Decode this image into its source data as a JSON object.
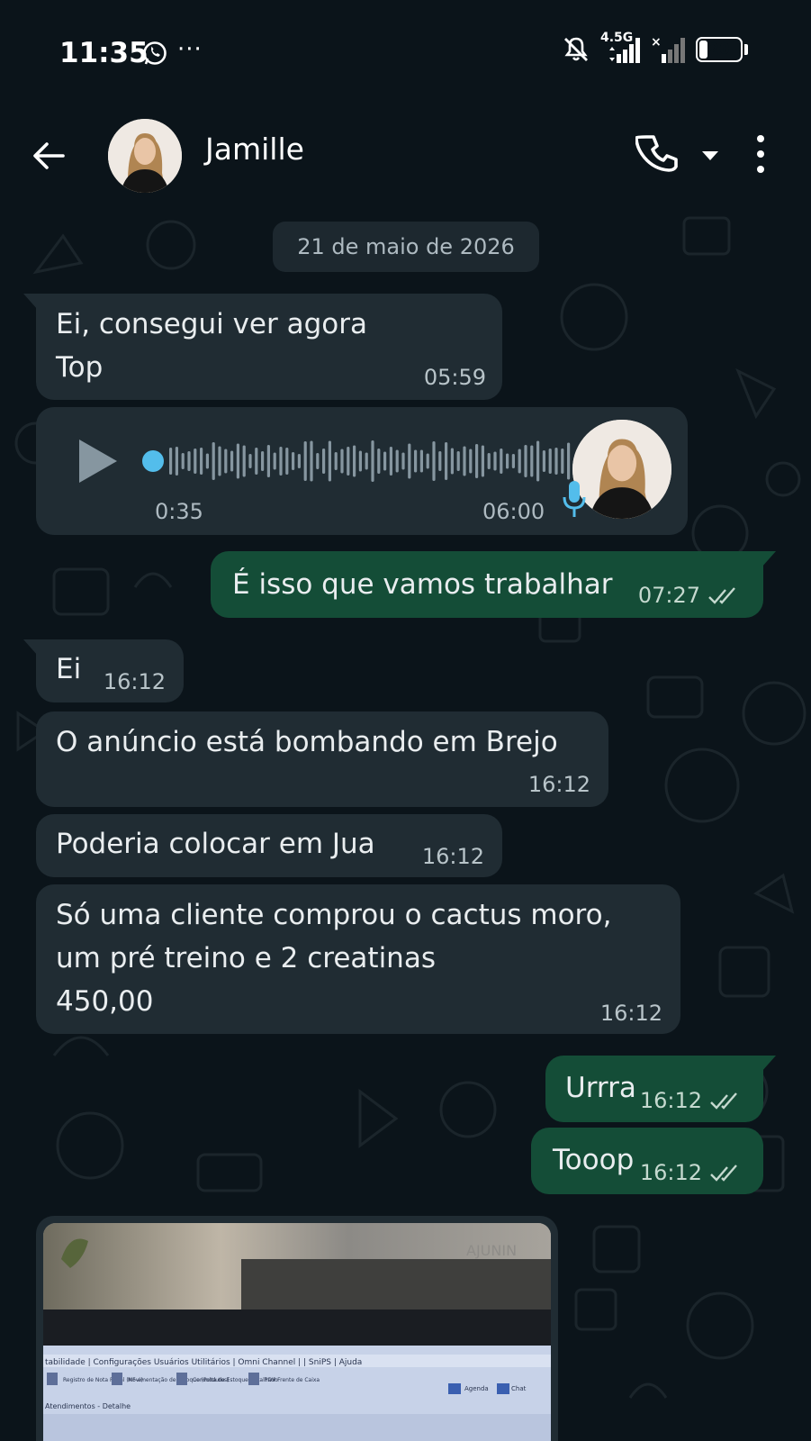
{
  "status_bar": {
    "time": "11:35",
    "dots": "···",
    "network": "4.5G",
    "battery": "20",
    "battery_level": 0.2
  },
  "header": {
    "contact_name": "Jamille"
  },
  "chat": {
    "date_chip": "21 de maio de 2026",
    "messages": [
      {
        "dir": "in",
        "text": "Ei, consegui ver agora\nTop",
        "time": "05:59"
      },
      {
        "dir": "in",
        "type": "audio",
        "duration": "0:35",
        "time": "06:00"
      },
      {
        "dir": "out",
        "text": "É isso que vamos trabalhar",
        "time": "07:27"
      },
      {
        "dir": "in",
        "text": "Ei",
        "time": "16:12"
      },
      {
        "dir": "in",
        "text": "O anúncio está bombando em Brejo",
        "time": "16:12"
      },
      {
        "dir": "in",
        "text": "Poderia colocar em Jua",
        "time": "16:12"
      },
      {
        "dir": "in",
        "text": "Só uma cliente comprou o cactus moro,\num pré treino e 2 creatinas\n450,00",
        "time": "16:12"
      },
      {
        "dir": "out",
        "text": "Urrra",
        "time": "16:12"
      },
      {
        "dir": "out",
        "text": "Tooop",
        "time": "16:12"
      },
      {
        "dir": "in",
        "type": "image"
      }
    ]
  },
  "photo_text": {
    "menu": "tabilidade  |  Configurações   Usuários   Utilitários  |  Omni Channel  |  |  SniPS  |  Ajuda",
    "btn1": "Registro de Nota Fiscal (NF-e)",
    "btn2": "Movimentação de Estoque (Produtos)",
    "btn3": "Consulta de Estoque Detalhado",
    "btn4": "PDV Frente de Caixa",
    "agenda": "Agenda",
    "chat": "Chat",
    "tab": "Atendimentos - Detalhe",
    "sign": "AJUNIN"
  },
  "colors": {
    "background": "#0b141a",
    "incoming": "#202c33",
    "outgoing": "#144d37",
    "accent_blue": "#53bdeb"
  },
  "icons": [
    "whatsapp-icon",
    "mute-icon",
    "signal-icon",
    "back-arrow-icon",
    "phone-icon",
    "chevron-down-icon",
    "more-vert-icon",
    "play-icon",
    "mic-icon",
    "double-check-icon"
  ]
}
